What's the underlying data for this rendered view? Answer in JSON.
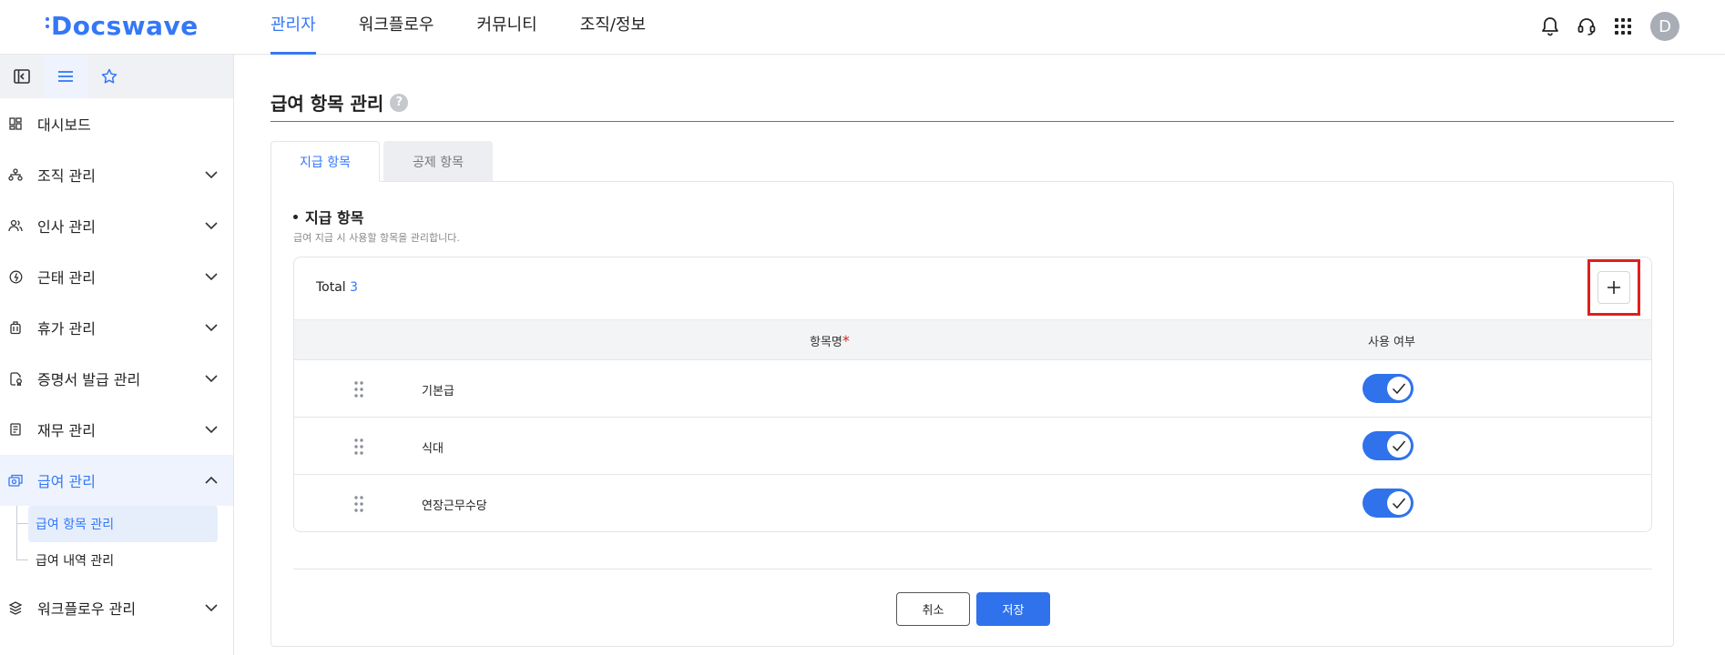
{
  "app": {
    "logo": "Docswave"
  },
  "topnav": {
    "items": [
      {
        "label": "관리자",
        "active": true
      },
      {
        "label": "워크플로우",
        "active": false
      },
      {
        "label": "커뮤니티",
        "active": false
      },
      {
        "label": "조직/정보",
        "active": false
      }
    ],
    "icons": [
      "bell-icon",
      "headset-icon",
      "apps-grid-icon"
    ],
    "avatar_initial": "D"
  },
  "sidebar": {
    "tabs": [
      "collapse-sidebar-icon",
      "menu-list-icon",
      "star-icon"
    ],
    "items": [
      {
        "label": "대시보드",
        "icon": "dashboard-icon",
        "expandable": false
      },
      {
        "label": "조직 관리",
        "icon": "org-chart-icon",
        "expandable": true
      },
      {
        "label": "인사 관리",
        "icon": "people-icon",
        "expandable": true
      },
      {
        "label": "근태 관리",
        "icon": "clock-icon",
        "expandable": true
      },
      {
        "label": "휴가 관리",
        "icon": "luggage-icon",
        "expandable": true
      },
      {
        "label": "증명서 발급 관리",
        "icon": "certificate-icon",
        "expandable": true
      },
      {
        "label": "재무 관리",
        "icon": "finance-icon",
        "expandable": true
      },
      {
        "label": "급여 관리",
        "icon": "payroll-icon",
        "expandable": true,
        "expanded": true,
        "active": true
      },
      {
        "label": "워크플로우 관리",
        "icon": "layers-icon",
        "expandable": true
      }
    ],
    "payroll_sub": [
      {
        "label": "급여 항목 관리",
        "active": true
      },
      {
        "label": "급여 내역 관리",
        "active": false
      }
    ]
  },
  "page": {
    "title": "급여 항목 관리",
    "help": "?",
    "tabs": [
      {
        "label": "지급 항목",
        "active": true
      },
      {
        "label": "공제 항목",
        "active": false
      }
    ],
    "section_title": "지급 항목",
    "section_desc": "급여 지급 시 사용할 항목을 관리합니다.",
    "total_label": "Total",
    "total_count": "3",
    "columns": {
      "name": "항목명",
      "required_mark": "*",
      "use": "사용 여부"
    },
    "rows": [
      {
        "name": "기본급",
        "enabled": true
      },
      {
        "name": "식대",
        "enabled": true
      },
      {
        "name": "연장근무수당",
        "enabled": true
      }
    ],
    "buttons": {
      "cancel": "취소",
      "save": "저장"
    }
  },
  "colors": {
    "accent": "#3478f6",
    "toggle_on": "#2f72ec",
    "highlight_box": "#e01e1e"
  }
}
